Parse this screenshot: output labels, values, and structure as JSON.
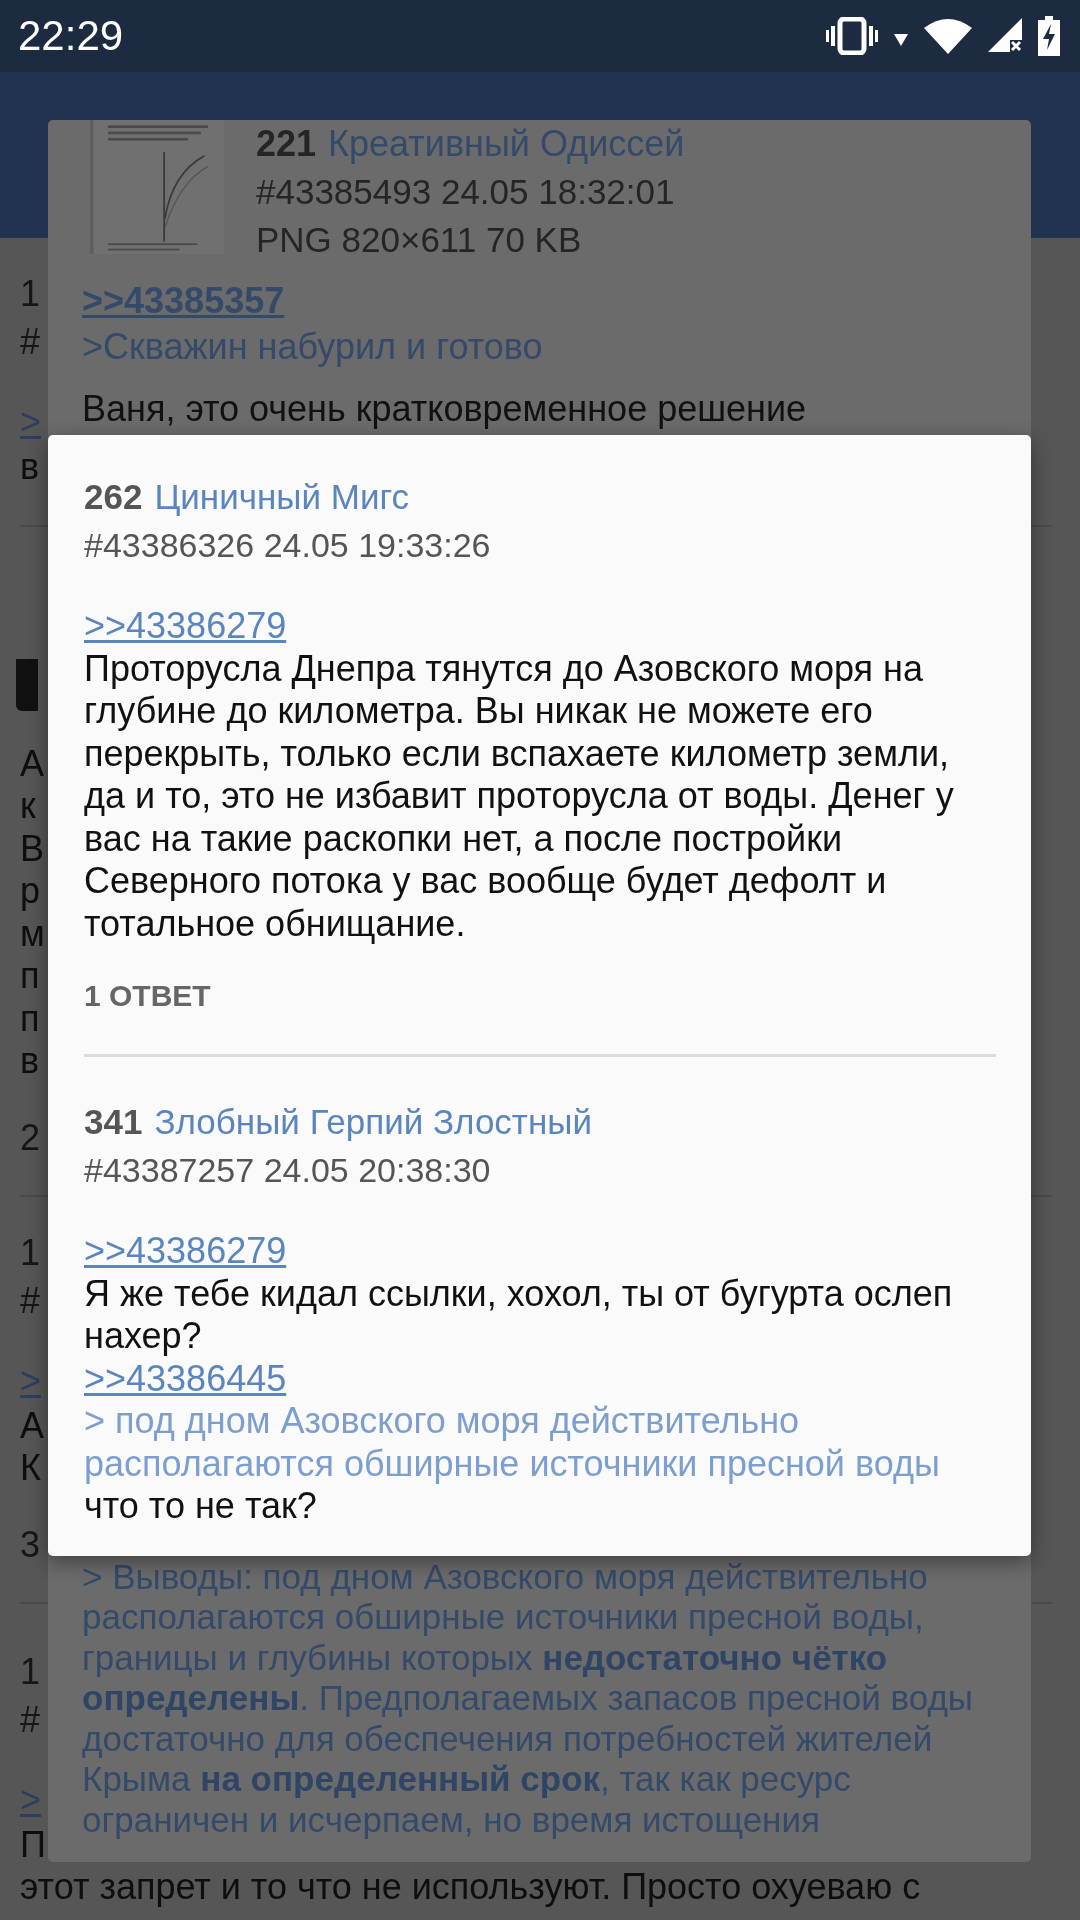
{
  "status_bar": {
    "time": "22:29"
  },
  "thread": [
    {
      "lines": [
        {
          "kind": "header",
          "text": "1"
        },
        {
          "kind": "header",
          "text": "#"
        },
        {
          "kind": "link",
          "text": ">"
        },
        {
          "kind": "text",
          "text": "в"
        }
      ]
    },
    {
      "lines": [
        {
          "kind": "thumb"
        },
        {
          "kind": "text",
          "text": "А"
        },
        {
          "kind": "text",
          "text": "к"
        },
        {
          "kind": "text",
          "text": "В"
        },
        {
          "kind": "text",
          "text": "р"
        },
        {
          "kind": "text",
          "text": "м"
        },
        {
          "kind": "text",
          "text": "п"
        },
        {
          "kind": "text",
          "text": "п"
        },
        {
          "kind": "text",
          "text": "в"
        },
        {
          "kind": "count",
          "text": "2"
        }
      ]
    },
    {
      "lines": [
        {
          "kind": "header",
          "text": "1"
        },
        {
          "kind": "header",
          "text": "#"
        },
        {
          "kind": "link",
          "text": ">"
        },
        {
          "kind": "text",
          "text": "А"
        },
        {
          "kind": "text",
          "text": "К"
        },
        {
          "kind": "count",
          "text": "3"
        }
      ]
    },
    {
      "lines": [
        {
          "kind": "header",
          "text": "1"
        },
        {
          "kind": "header",
          "text": "#"
        },
        {
          "kind": "link",
          "text": ">"
        },
        {
          "kind": "text",
          "text": "П"
        },
        {
          "kind": "text",
          "text": "этот запрет и то что не используют. Просто охуеваю с"
        }
      ]
    }
  ],
  "popup_back": {
    "number": "221",
    "name": "Креативный Одиссей",
    "meta": "#43385493 24.05 18:32:01",
    "file": "PNG 820×611 70 KB",
    "blocks": [
      {
        "kind": "link",
        "text": ">>43385357"
      },
      {
        "kind": "quote",
        "text": ">Скважин набурил и готово"
      },
      {
        "kind": "text",
        "text": "Ваня, это очень кратковременное решение"
      }
    ],
    "tail": {
      "kind": "quote",
      "text": "> Выводы: под дном Азовского моря действительно располагаются обширные источники пресной воды, границы и глубины которых **недостаточно чётко определены**. Предполагаемых запасов пресной воды достаточно для обеспечения потребностей жителей Крыма **на определенный срок**, так как ресурс ограничен и исчерпаем, но время истощения"
    }
  },
  "popup_front": {
    "posts": [
      {
        "number": "262",
        "name": "Циничный Мигс",
        "meta": "#43386326 24.05 19:33:26",
        "blocks": [
          {
            "kind": "link",
            "text": ">>43386279"
          },
          {
            "kind": "text",
            "text": "Проторусла Днепра тянутся до Азовского моря на глубине до километра. Вы никак не можете его перекрыть, только если вспахаете километр земли, да и то, это не избавит проторусла от воды. Денег у вас на такие раскопки нет, а после постройки Северного потока у вас вообще будет дефолт и тотальное обнищание."
          }
        ],
        "replies": "1 ОТВЕТ"
      },
      {
        "number": "341",
        "name": "Злобный Герпий Злостный",
        "meta": "#43387257 24.05 20:38:30",
        "blocks": [
          {
            "kind": "link",
            "text": ">>43386279"
          },
          {
            "kind": "text",
            "text": "Я же тебе кидал ссылки, хохол, ты от бугурта ослеп нахер?"
          },
          {
            "kind": "link",
            "text": ">>43386445"
          },
          {
            "kind": "quote",
            "text": "> под дном Азовского моря действительно располагаются обширные источники пресной воды"
          },
          {
            "kind": "text",
            "text": "что то не так?"
          }
        ]
      }
    ]
  }
}
